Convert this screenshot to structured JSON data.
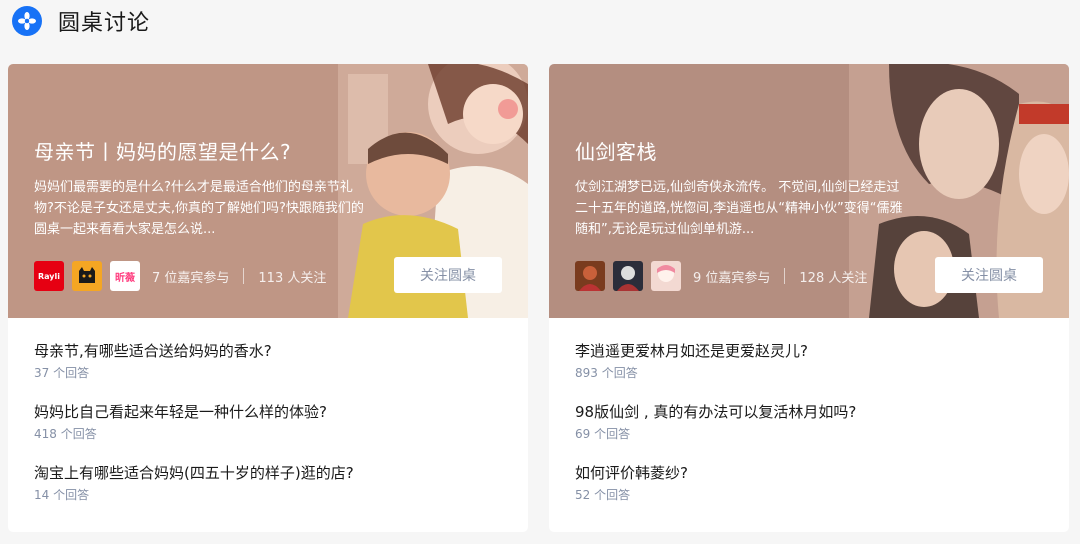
{
  "header": {
    "title": "圆桌讨论",
    "logo_icon": "zhihu-roundtable-icon",
    "logo_color": "#1772f6"
  },
  "roundtables": [
    {
      "banner_color": "#b8907f",
      "title": "母亲节丨妈妈的愿望是什么?",
      "description": "妈妈们最需要的是什么?什么才是最适合他们的母亲节礼物?不论是子女还是丈夫,你真的了解她们吗?快跟随我们的圆桌一起来看看大家是怎么说...",
      "guests": "7 位嘉宾参与",
      "followers": "113 人关注",
      "follow_label": "关注圆桌",
      "avatars": [
        {
          "name": "Rayli",
          "label": "Rayli",
          "color": "#e60012"
        },
        {
          "name": "cat-avatar",
          "label": "",
          "color": "#f5a623"
        },
        {
          "name": "brand-avatar",
          "label": "昕薇",
          "color": "#ff3d7f"
        }
      ],
      "questions": [
        {
          "title": "母亲节,有哪些适合送给妈妈的香水?",
          "answers": "37 个回答"
        },
        {
          "title": "妈妈比自己看起来年轻是一种什么样的体验?",
          "answers": "418 个回答"
        },
        {
          "title": "淘宝上有哪些适合妈妈(四五十岁的样子)逛的店?",
          "answers": "14 个回答"
        }
      ]
    },
    {
      "banner_color": "#b08a7c",
      "title": "仙剑客栈",
      "description": "仗剑江湖梦已远,仙剑奇侠永流传。 不觉间,仙剑已经走过二十五年的道路,恍惚间,李逍遥也从“精神小伙”变得“儒雅随和”,无论是玩过仙剑单机游...",
      "guests": "9 位嘉宾参与",
      "followers": "128 人关注",
      "follow_label": "关注圆桌",
      "avatars": [
        {
          "name": "guest-avatar-1",
          "label": "",
          "color": "#7a3b1e"
        },
        {
          "name": "guest-avatar-2",
          "label": "",
          "color": "#2b2d3a"
        },
        {
          "name": "guest-avatar-3",
          "label": "",
          "color": "#f3d9d2"
        }
      ],
      "questions": [
        {
          "title": "李逍遥更爱林月如还是更爱赵灵儿?",
          "answers": "893 个回答"
        },
        {
          "title": "98版仙剑 , 真的有办法可以复活林月如吗?",
          "answers": "69 个回答"
        },
        {
          "title": "如何评价韩菱纱?",
          "answers": "52 个回答"
        }
      ]
    }
  ]
}
